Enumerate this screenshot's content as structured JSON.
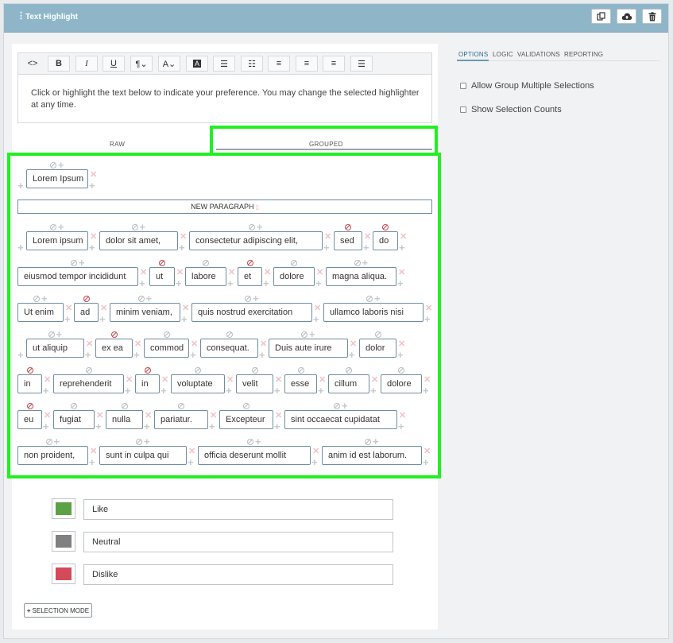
{
  "header": {
    "title": "Text Highlight"
  },
  "toolbar": {
    "buttons": [
      "code",
      "bold",
      "italic",
      "underline",
      "paragraph",
      "font-color",
      "highlight",
      "bullet-list",
      "numbered-list",
      "align-left",
      "align-center",
      "align-right",
      "justify"
    ]
  },
  "editor": {
    "text": "Click or highlight the text below to indicate your preference. You may change the selected highlighter at any time."
  },
  "tabs": {
    "raw": "RAW",
    "grouped": "GROUPED"
  },
  "grouped": {
    "title_word": "Lorem Ipsum",
    "new_paragraph": "NEW PARAGRAPH",
    "words": [
      "Lorem ipsum",
      "dolor sit amet,",
      "consectetur adipiscing elit,",
      "sed",
      "do",
      "eiusmod tempor incididunt",
      "ut",
      "labore",
      "et",
      "dolore",
      "magna aliqua.",
      "Ut enim",
      "ad",
      "minim veniam,",
      "quis nostrud exercitation",
      "ullamco laboris nisi",
      "ut aliquip",
      "ex ea",
      "commod",
      "consequat.",
      "Duis aute irure",
      "dolor",
      "in",
      "reprehenderit",
      "in",
      "voluptate",
      "velit",
      "esse",
      "cillum",
      "dolore",
      "eu",
      "fugiat",
      "nulla",
      "pariatur.",
      "Excepteur",
      "sint occaecat cupidatat",
      "non proident,",
      "sunt in culpa qui",
      "officia deserunt mollit",
      "anim id est laborum."
    ]
  },
  "highlighters": [
    {
      "label": "Like",
      "color": "#5aa245"
    },
    {
      "label": "Neutral",
      "color": "#808080"
    },
    {
      "label": "Dislike",
      "color": "#d34b5a"
    }
  ],
  "selection_mode": "SELECTION MODE",
  "right_tabs": [
    "OPTIONS",
    "LOGIC",
    "VALIDATIONS",
    "REPORTING"
  ],
  "options": [
    {
      "label": "Allow Group Multiple Selections",
      "checked": false
    },
    {
      "label": "Show Selection Counts",
      "checked": false
    }
  ]
}
